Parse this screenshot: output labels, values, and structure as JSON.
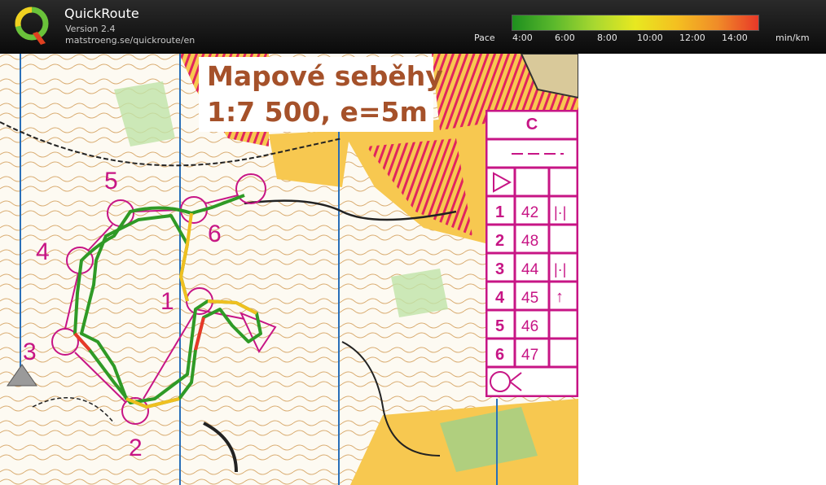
{
  "app": {
    "title": "QuickRoute",
    "version": "Version 2.4",
    "url": "matstroeng.se/quickroute/en"
  },
  "pace_legend": {
    "label": "Pace",
    "ticks": [
      "4:00",
      "6:00",
      "8:00",
      "10:00",
      "12:00",
      "14:00"
    ],
    "unit": "min/km",
    "colors": [
      "#1e8f1e",
      "#5ab82c",
      "#a8d830",
      "#e8e820",
      "#f4c020",
      "#f08c28",
      "#e83828"
    ]
  },
  "map": {
    "title_line1": "Mapové seběhy",
    "title_line2": "1:7 500, e=5m",
    "controls": [
      "1",
      "2",
      "3",
      "4",
      "5",
      "6"
    ]
  },
  "control_description": {
    "course": "C",
    "rows": [
      {
        "num": "1",
        "code": "42",
        "symbol": "|·|"
      },
      {
        "num": "2",
        "code": "48",
        "symbol": ""
      },
      {
        "num": "3",
        "code": "44",
        "symbol": "|·|"
      },
      {
        "num": "4",
        "code": "45",
        "symbol": "↑"
      },
      {
        "num": "5",
        "code": "46",
        "symbol": ""
      },
      {
        "num": "6",
        "code": "47",
        "symbol": ""
      }
    ]
  }
}
